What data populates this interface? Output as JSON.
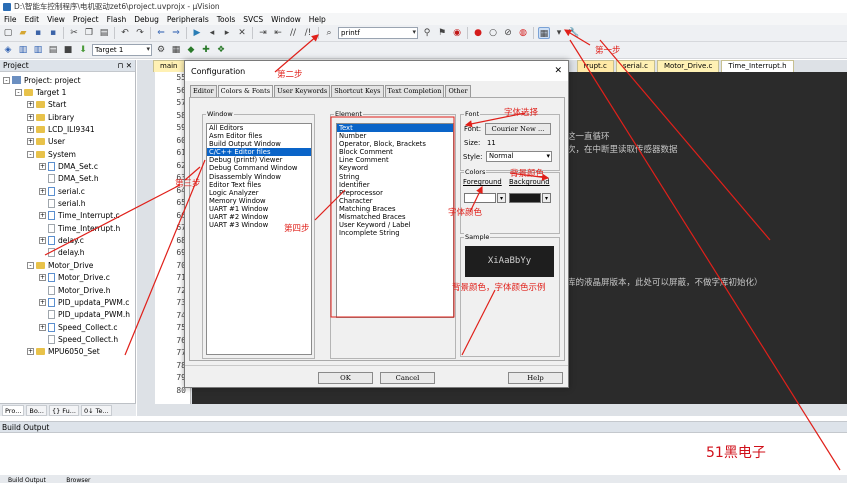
{
  "window": {
    "title": "D:\\智能车控制程序\\电机驱动zet6\\project.uvprojx - µVision"
  },
  "menu": [
    "File",
    "Edit",
    "View",
    "Project",
    "Flash",
    "Debug",
    "Peripherals",
    "Tools",
    "SVCS",
    "Window",
    "Help"
  ],
  "toolbar": {
    "find_value": "printf",
    "target": "Target 1"
  },
  "project_panel": {
    "title": "Project",
    "tree": [
      {
        "label": "Project: project",
        "level": 0,
        "kind": "proj",
        "exp": "-"
      },
      {
        "label": "Target 1",
        "level": 1,
        "kind": "fold",
        "exp": "-"
      },
      {
        "label": "Start",
        "level": 2,
        "kind": "fold",
        "exp": "+"
      },
      {
        "label": "Library",
        "level": 2,
        "kind": "fold",
        "exp": "+"
      },
      {
        "label": "LCD_ILI9341",
        "level": 2,
        "kind": "fold",
        "exp": "+"
      },
      {
        "label": "User",
        "level": 2,
        "kind": "fold",
        "exp": "+"
      },
      {
        "label": "System",
        "level": 2,
        "kind": "fold",
        "exp": "-"
      },
      {
        "label": "DMA_Set.c",
        "level": 3,
        "kind": "filec",
        "exp": "+"
      },
      {
        "label": "DMA_Set.h",
        "level": 3,
        "kind": "file",
        "exp": ""
      },
      {
        "label": "serial.c",
        "level": 3,
        "kind": "filec",
        "exp": "+"
      },
      {
        "label": "serial.h",
        "level": 3,
        "kind": "file",
        "exp": ""
      },
      {
        "label": "Time_Interrupt.c",
        "level": 3,
        "kind": "filec",
        "exp": "+"
      },
      {
        "label": "Time_Interrupt.h",
        "level": 3,
        "kind": "file",
        "exp": ""
      },
      {
        "label": "delay.c",
        "level": 3,
        "kind": "filec",
        "exp": "+"
      },
      {
        "label": "delay.h",
        "level": 3,
        "kind": "file",
        "exp": ""
      },
      {
        "label": "Motor_Drive",
        "level": 2,
        "kind": "fold",
        "exp": "-"
      },
      {
        "label": "Motor_Drive.c",
        "level": 3,
        "kind": "filec",
        "exp": "+"
      },
      {
        "label": "Motor_Drive.h",
        "level": 3,
        "kind": "file",
        "exp": ""
      },
      {
        "label": "PID_updata_PWM.c",
        "level": 3,
        "kind": "filec",
        "exp": "+"
      },
      {
        "label": "PID_updata_PWM.h",
        "level": 3,
        "kind": "file",
        "exp": ""
      },
      {
        "label": "Speed_Collect.c",
        "level": 3,
        "kind": "filec",
        "exp": "+"
      },
      {
        "label": "Speed_Collect.h",
        "level": 3,
        "kind": "file",
        "exp": ""
      },
      {
        "label": "MPU6050_Set",
        "level": 2,
        "kind": "fold",
        "exp": "+"
      }
    ],
    "bottom_tabs": [
      "Pro...",
      "Bo...",
      "{} Fu...",
      "0↓ Te..."
    ]
  },
  "file_tabs": [
    "main",
    "rrupt.c",
    "serial.c",
    "Motor_Drive.c",
    "Time_Interrupt.h"
  ],
  "line_numbers": [
    "55",
    "56",
    "57",
    "58",
    "59",
    "60",
    "61",
    "62",
    "63",
    "64",
    "65",
    "66",
    "67",
    "68",
    "69",
    "70",
    "71",
    "72",
    "73",
    "74",
    "75",
    "76",
    "77",
    "78",
    "79",
    "80"
  ],
  "code_text": {
    "line1": "这一直循环",
    "line2": "次，在中断里读取传感器数据",
    "line3": "库的液晶屏版本，此处可以屏蔽，不做字库初始化）"
  },
  "build": {
    "title": "Build Output",
    "tabs": [
      "Build Output",
      "Browser"
    ]
  },
  "watermark": "51黑电子",
  "dialog": {
    "title": "Configuration",
    "tabs": [
      "Editor",
      "Colors & Fonts",
      "User Keywords",
      "Shortcut Keys",
      "Text Completion",
      "Other"
    ],
    "window_label": "Window",
    "window_items": [
      "All Editors",
      "Asm Editor files",
      "Build Output Window",
      "C/C++ Editor files",
      "Debug (printf) Viewer",
      "Debug Command Window",
      "Disassembly Window",
      "Editor Text files",
      "Logic Analyzer",
      "Memory Window",
      "UART #1 Window",
      "UART #2 Window",
      "UART #3 Window"
    ],
    "window_selected": 3,
    "element_label": "Element",
    "element_items": [
      "Text",
      "Number",
      "Operator, Block, Brackets",
      "Block Comment",
      "Line Comment",
      "Keyword",
      "String",
      "Identifier",
      "Preprocessor",
      "Character",
      "Matching Braces",
      "Mismatched Braces",
      "User Keyword / Label",
      "Incomplete String"
    ],
    "element_selected": 0,
    "font_label": "Font",
    "font_field_label": "Font:",
    "font_value": "Courier New ...",
    "size_label": "Size:",
    "size_value": "11",
    "style_label": "Style:",
    "style_value": "Normal",
    "colors_label": "Colors",
    "foreground_label": "Foreground",
    "background_label": "Background",
    "sample_label": "Sample",
    "sample_text": "XiAaBbYy",
    "ok_label": "OK",
    "cancel_label": "Cancel",
    "help_label": "Help"
  },
  "annotations": {
    "step1": "第一步",
    "step2": "第二步",
    "step3": "第三步",
    "step4": "第四步",
    "font_select": "字体选择",
    "bg_color": "背景颜色",
    "font_color": "字体颜色",
    "sample": "背景颜色，字体颜色示例"
  },
  "colors": {
    "accent_red": "#e0201a",
    "selection": "#0a64c8",
    "code_bg": "#2b2b2b"
  }
}
